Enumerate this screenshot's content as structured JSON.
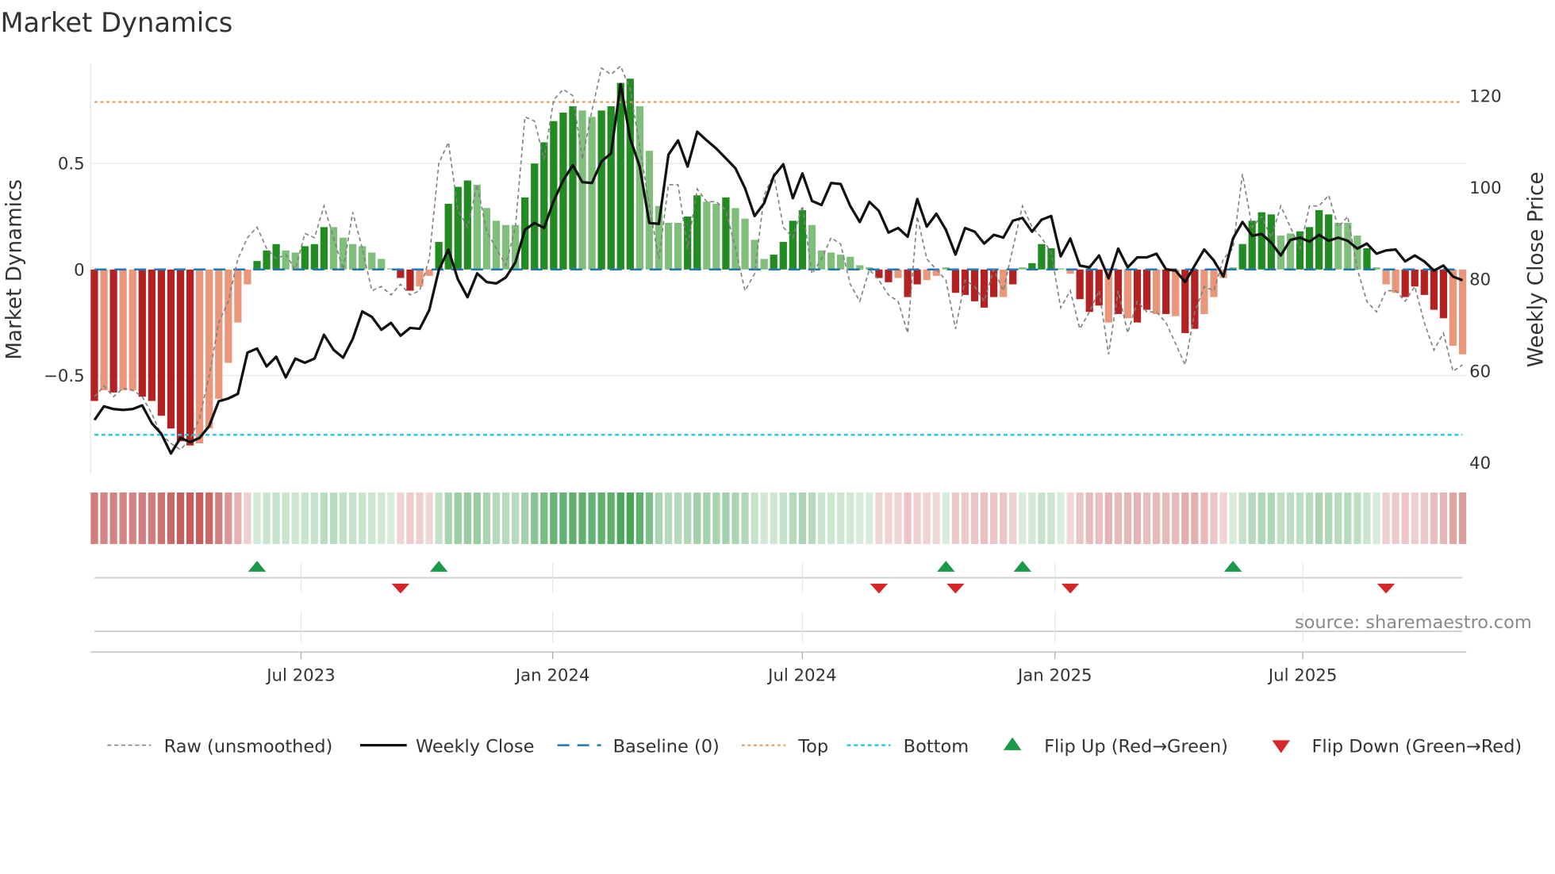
{
  "chart_data": {
    "type": "bar",
    "title": "Market Dynamics",
    "ylabel_left": "Market Dynamics",
    "ylabel_right": "Weekly Close Price",
    "source": "source: sharemaestro.com",
    "ylim_left": [
      -0.963,
      0.972
    ],
    "ylim_right": [
      37.6,
      127.1
    ],
    "xlim_weeks": [
      -0.4,
      143.4
    ],
    "yticks_left": [
      {
        "v": 0.5,
        "label": "0.5"
      },
      {
        "v": 0,
        "label": "0"
      },
      {
        "v": -0.5,
        "label": "−0.5"
      }
    ],
    "yticks_right": [
      {
        "v": 120,
        "label": "120"
      },
      {
        "v": 100,
        "label": "100"
      },
      {
        "v": 80,
        "label": "80"
      },
      {
        "v": 60,
        "label": "60"
      },
      {
        "v": 40,
        "label": "40"
      }
    ],
    "xticks": [
      {
        "week": 21.6,
        "label": "Jul 2023"
      },
      {
        "week": 47.9,
        "label": "Jan 2024"
      },
      {
        "week": 74.0,
        "label": "Jul 2024"
      },
      {
        "week": 100.4,
        "label": "Jan 2025"
      },
      {
        "week": 126.3,
        "label": "Jul 2025"
      }
    ],
    "thresholds": {
      "baseline": 0,
      "top": 0.79,
      "bottom": -0.78
    },
    "colors": {
      "dark_red": "#b22222",
      "light_red": "#e9967a",
      "dark_green": "#228b22",
      "light_green": "#7fbf7b",
      "close": "#111111",
      "raw": "#808080",
      "baseline": "#1f77b4",
      "top": "#e0a060",
      "bottom": "#30c8d8",
      "flip_up": "#1a9a48",
      "flip_down": "#d62728"
    },
    "smoothed": [
      -0.62,
      -0.57,
      -0.58,
      -0.57,
      -0.57,
      -0.6,
      -0.62,
      -0.69,
      -0.75,
      -0.81,
      -0.83,
      -0.82,
      -0.75,
      -0.61,
      -0.44,
      -0.25,
      -0.07,
      0.04,
      0.09,
      0.12,
      0.09,
      0.08,
      0.11,
      0.12,
      0.2,
      0.2,
      0.15,
      0.12,
      0.11,
      0.08,
      0.05,
      0.005,
      -0.04,
      -0.1,
      -0.08,
      -0.03,
      0.13,
      0.31,
      0.39,
      0.42,
      0.4,
      0.29,
      0.23,
      0.21,
      0.21,
      0.34,
      0.5,
      0.6,
      0.7,
      0.74,
      0.77,
      0.75,
      0.72,
      0.75,
      0.77,
      0.88,
      0.9,
      0.77,
      0.56,
      0.3,
      0.22,
      0.22,
      0.25,
      0.35,
      0.32,
      0.31,
      0.34,
      0.29,
      0.24,
      0.14,
      0.05,
      0.07,
      0.13,
      0.23,
      0.28,
      0.21,
      0.09,
      0.08,
      0.07,
      0.06,
      0.02,
      0.01,
      -0.04,
      -0.06,
      -0.04,
      -0.13,
      -0.07,
      -0.05,
      -0.03,
      0.01,
      -0.11,
      -0.12,
      -0.15,
      -0.18,
      -0.13,
      -0.13,
      -0.07,
      0.01,
      0.03,
      0.12,
      0.1,
      0.005,
      -0.02,
      -0.14,
      -0.2,
      -0.17,
      -0.25,
      -0.21,
      -0.23,
      -0.25,
      -0.19,
      -0.21,
      -0.21,
      -0.22,
      -0.3,
      -0.28,
      -0.21,
      -0.13,
      -0.04,
      0.01,
      0.12,
      0.23,
      0.27,
      0.26,
      0.16,
      0.17,
      0.18,
      0.2,
      0.28,
      0.26,
      0.22,
      0.22,
      0.16,
      0.1,
      0.01,
      -0.07,
      -0.11,
      -0.13,
      -0.08,
      -0.12,
      -0.19,
      -0.23,
      -0.36,
      -0.4
    ],
    "shade": "dldlldddddd llllllddd llddd lllllll ddllddddllllldddddd llddddlllll ddlldlllldddd lllllll ddlddllldddddl dlddd lldddldldd ldlddllllddddlldddd llldlllddddd",
    "raw": [
      -0.6,
      -0.55,
      -0.6,
      -0.56,
      -0.57,
      -0.6,
      -0.68,
      -0.78,
      -0.82,
      -0.85,
      -0.8,
      -0.7,
      -0.5,
      -0.25,
      -0.15,
      0.05,
      0.15,
      0.2,
      0.1,
      0.05,
      0.07,
      0.0,
      0.17,
      0.15,
      0.3,
      0.15,
      0.0,
      0.27,
      0.1,
      -0.1,
      -0.08,
      -0.12,
      -0.07,
      -0.12,
      -0.1,
      0.05,
      0.5,
      0.6,
      0.28,
      0.2,
      0.4,
      0.18,
      0.1,
      0.02,
      0.2,
      0.72,
      0.7,
      0.52,
      0.8,
      0.85,
      0.82,
      0.52,
      0.75,
      0.95,
      0.92,
      0.96,
      0.85,
      0.58,
      0.3,
      0.05,
      0.4,
      0.4,
      0.1,
      0.38,
      0.32,
      0.32,
      0.28,
      0.1,
      -0.1,
      -0.02,
      0.35,
      0.45,
      0.2,
      0.15,
      0.3,
      -0.02,
      0.05,
      0.15,
      0.12,
      -0.07,
      -0.15,
      0.0,
      -0.05,
      -0.12,
      -0.15,
      -0.3,
      0.25,
      0.05,
      0.0,
      -0.05,
      -0.28,
      -0.05,
      -0.08,
      -0.15,
      0.0,
      -0.1,
      0.1,
      0.3,
      0.2,
      0.15,
      0.08,
      -0.18,
      -0.1,
      -0.28,
      -0.2,
      -0.1,
      -0.4,
      -0.1,
      -0.3,
      -0.15,
      -0.2,
      -0.2,
      -0.25,
      -0.35,
      -0.45,
      -0.2,
      -0.08,
      -0.1,
      0.05,
      0.1,
      0.45,
      0.2,
      0.25,
      0.15,
      0.3,
      0.2,
      0.1,
      0.3,
      0.3,
      0.35,
      0.2,
      0.25,
      0.0,
      -0.15,
      -0.2,
      -0.1,
      -0.1,
      -0.15,
      -0.08,
      -0.25,
      -0.38,
      -0.3,
      -0.48,
      -0.45
    ],
    "close": [
      49.3,
      52.3,
      51.7,
      51.5,
      51.7,
      52.5,
      48.6,
      46.3,
      42.0,
      45.4,
      44.5,
      45.4,
      48.0,
      53.4,
      54.0,
      55.0,
      64.0,
      64.9,
      61.0,
      63.1,
      58.6,
      62.7,
      61.8,
      62.7,
      67.9,
      64.6,
      62.9,
      67.0,
      73.0,
      71.8,
      69.0,
      70.5,
      67.7,
      69.4,
      69.2,
      73.3,
      82.0,
      86.5,
      80.0,
      76.1,
      81.3,
      79.4,
      79.1,
      80.4,
      83.7,
      90.8,
      92.3,
      91.2,
      97.1,
      101.6,
      104.9,
      101.2,
      101.0,
      105.7,
      107.5,
      122.6,
      110.7,
      104.6,
      92.3,
      92.1,
      107.2,
      110.3,
      104.6,
      112.2,
      110.3,
      108.5,
      106.4,
      104.2,
      99.9,
      93.8,
      96.6,
      102.5,
      105.1,
      97.7,
      103.1,
      97.1,
      96.2,
      101.0,
      100.8,
      96.0,
      92.5,
      96.9,
      94.9,
      90.2,
      91.2,
      89.3,
      97.5,
      91.5,
      94.3,
      90.8,
      85.4,
      91.2,
      90.4,
      87.8,
      89.7,
      89.1,
      92.8,
      93.4,
      90.4,
      93.0,
      93.8,
      85.0,
      88.9,
      83.0,
      82.6,
      85.2,
      80.2,
      86.7,
      82.6,
      84.8,
      84.8,
      85.6,
      82.2,
      81.9,
      79.4,
      83.0,
      86.5,
      84.1,
      80.6,
      88.9,
      92.5,
      89.5,
      89.9,
      88.0,
      85.2,
      88.6,
      89.1,
      88.2,
      89.7,
      88.4,
      89.1,
      88.4,
      86.7,
      87.8,
      85.6,
      86.3,
      86.5,
      83.9,
      85.2,
      83.9,
      81.9,
      83.0,
      80.6,
      79.8
    ],
    "flip_up_weeks": [
      17,
      36,
      89,
      97,
      119
    ],
    "flip_down_weeks": [
      32,
      82,
      90,
      102,
      135
    ],
    "legend": {
      "raw": "Raw (unsmoothed)",
      "close": "Weekly Close",
      "baseline": "Baseline (0)",
      "top": "Top",
      "bottom": "Bottom",
      "flip_up": "Flip Up (Red→Green)",
      "flip_down": "Flip Down (Green→Red)"
    }
  }
}
